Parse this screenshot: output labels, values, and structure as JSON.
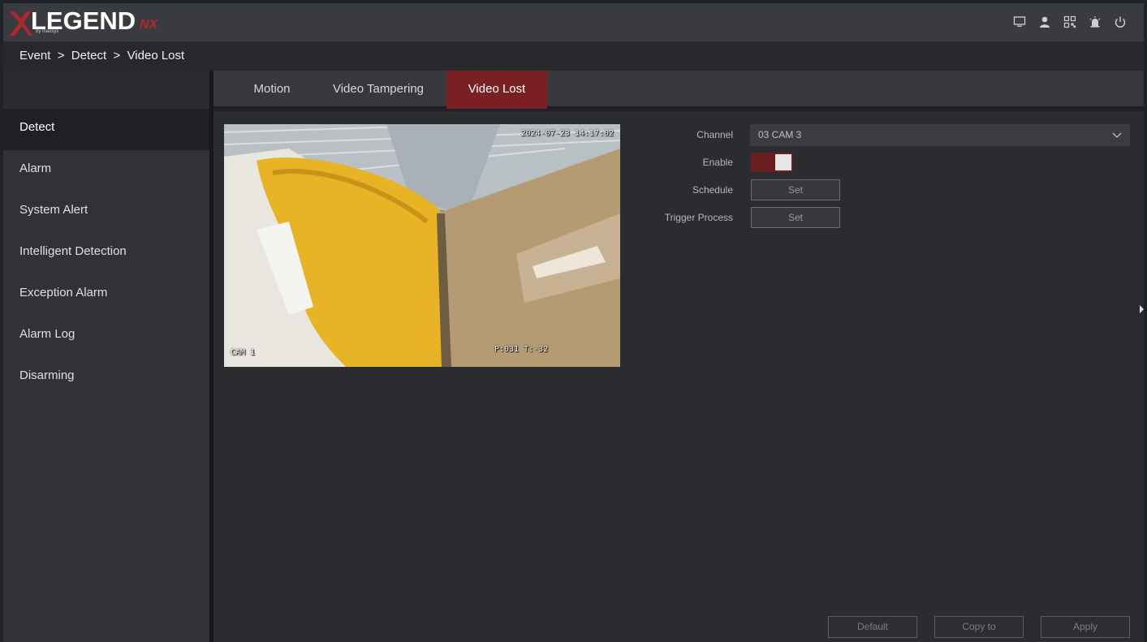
{
  "app": {
    "logo_text": "LEGEND",
    "logo_suffix": "NX",
    "logo_sub": "by Inaxsys"
  },
  "header": {
    "icons": [
      "monitor-icon",
      "user-icon",
      "qr-code-icon",
      "alarm-icon",
      "power-icon"
    ]
  },
  "breadcrumb": "Event  >  Detect  >  Video Lost",
  "sidebar": {
    "items": [
      {
        "label": "Detect",
        "active": true
      },
      {
        "label": "Alarm"
      },
      {
        "label": "System Alert"
      },
      {
        "label": "Intelligent Detection"
      },
      {
        "label": "Exception Alarm"
      },
      {
        "label": "Alarm Log"
      },
      {
        "label": "Disarming"
      }
    ]
  },
  "tabs": [
    {
      "label": "Motion"
    },
    {
      "label": "Video Tampering"
    },
    {
      "label": "Video Lost",
      "active": true
    }
  ],
  "preview": {
    "timestamp": "2024-07-23 14:17:02",
    "camera_label": "CAM 1",
    "ptz_readout": "P:031 T:-32"
  },
  "form": {
    "channel_label": "Channel",
    "channel_value": "03 CAM 3",
    "enable_label": "Enable",
    "enable_on": true,
    "schedule_label": "Schedule",
    "schedule_button": "Set",
    "trigger_label": "Trigger Process",
    "trigger_button": "Set"
  },
  "footer": {
    "default_label": "Default",
    "copy_label": "Copy to",
    "apply_label": "Apply"
  },
  "colors": {
    "accent": "#7a2023",
    "brand_red": "#b3262b"
  }
}
